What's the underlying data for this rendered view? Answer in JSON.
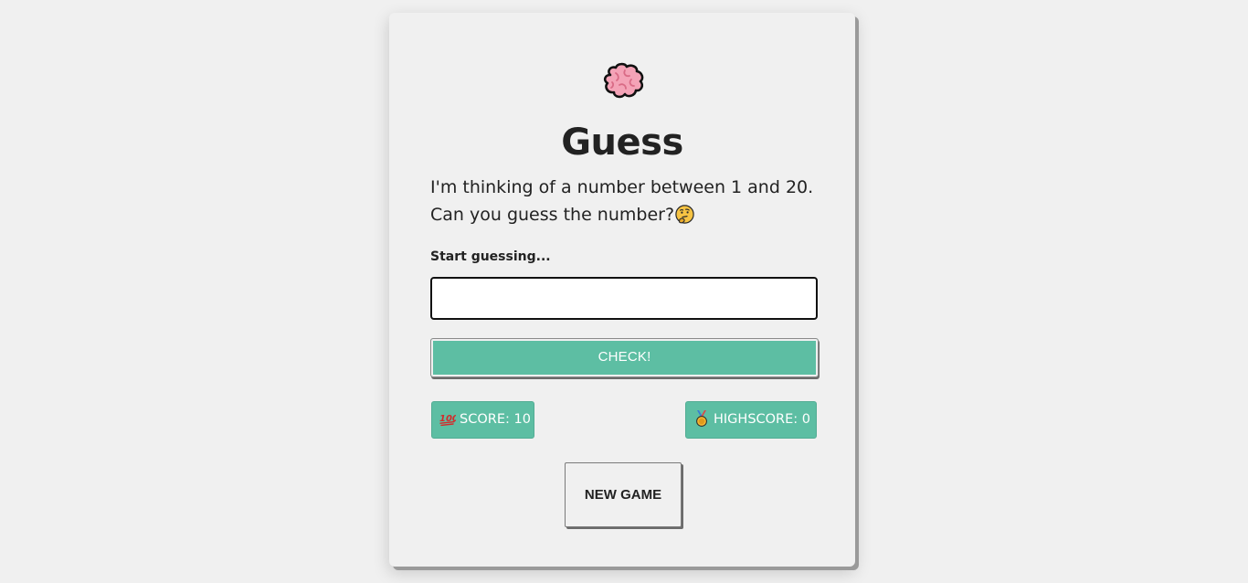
{
  "game": {
    "logo_icon": "brain-icon",
    "title": "Guess",
    "description_line1": "I'm thinking of a number between 1 and 20.",
    "description_line2": "Can you guess the number?",
    "description_icon": "thinking-face-icon",
    "input_label": "Start guessing...",
    "input_value": "",
    "check_button_label": "CHECK!",
    "score_icon": "hundred-points-icon",
    "score_text": "SCORE: 10",
    "score": 10,
    "highscore_icon": "medal-icon",
    "highscore_text": "HIGHSCORE: 0",
    "highscore": 0,
    "new_game_button_label": "NEW GAME"
  },
  "colors": {
    "background": "#f0f0f0",
    "accent": "#5dbea3",
    "text": "#222222",
    "input_bg": "#ffffff"
  }
}
